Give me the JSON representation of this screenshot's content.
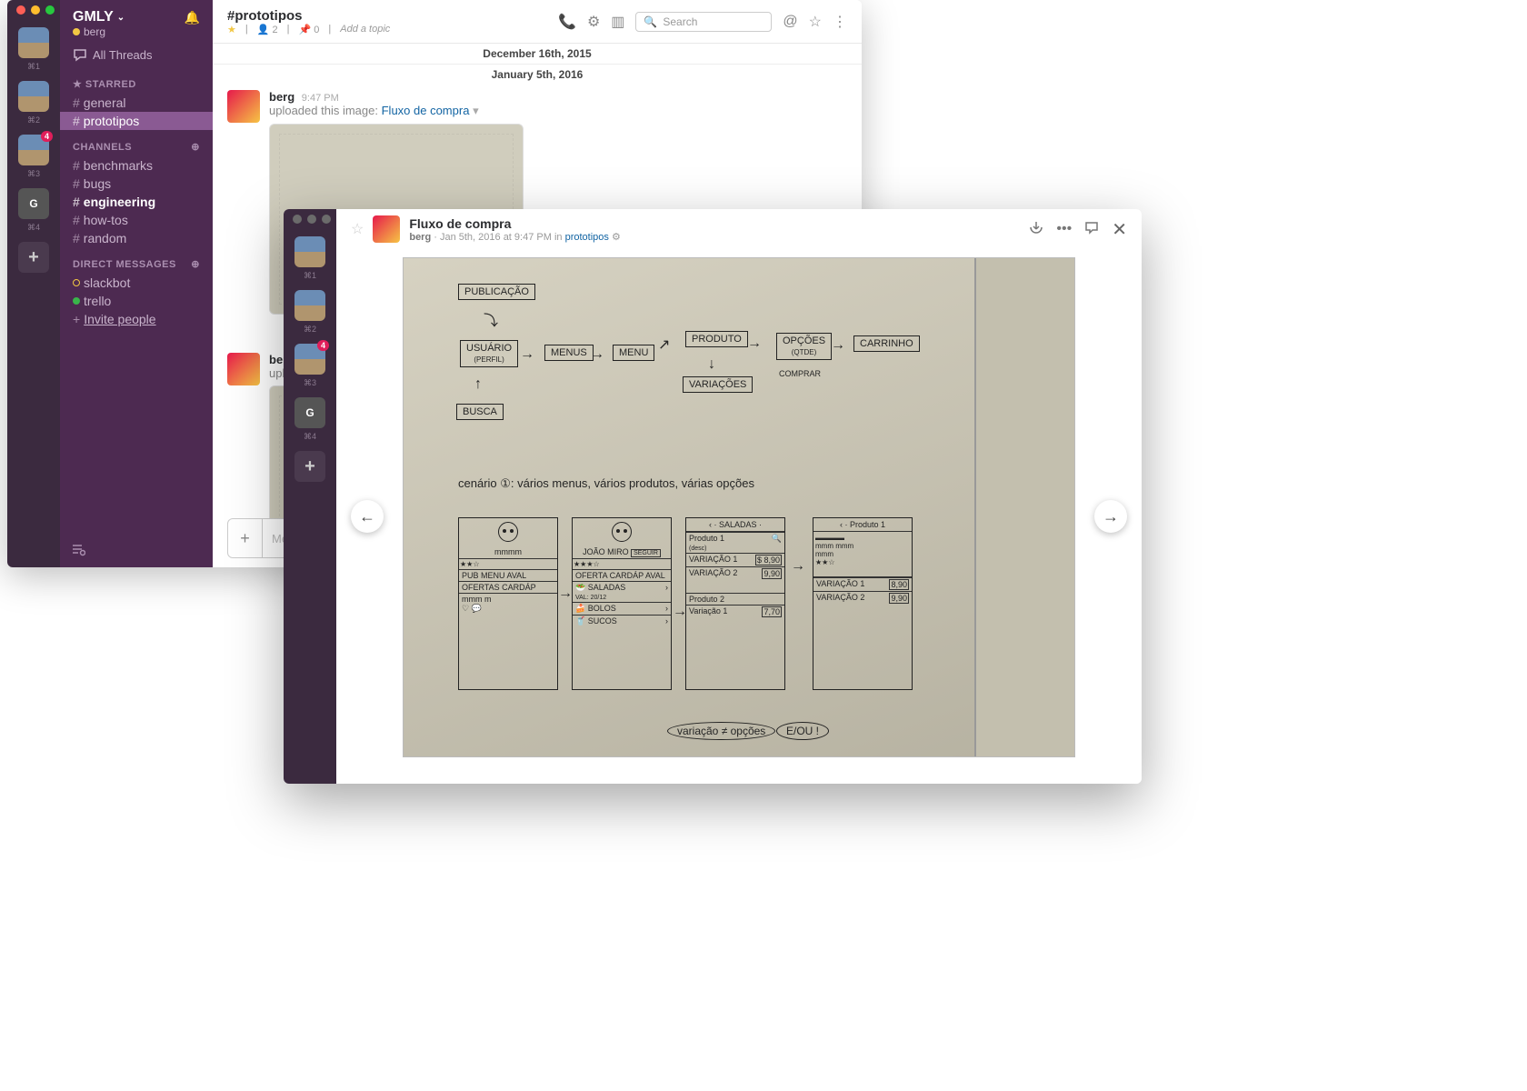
{
  "slack": {
    "team_name": "GMLY",
    "user_name": "berg",
    "all_threads": "All Threads",
    "sections": {
      "starred": "STARRED",
      "channels": "CHANNELS",
      "dms": "DIRECT MESSAGES"
    },
    "starred": [
      {
        "name": "general"
      },
      {
        "name": "prototipos",
        "selected": true
      }
    ],
    "channels": [
      {
        "name": "benchmarks"
      },
      {
        "name": "bugs"
      },
      {
        "name": "engineering",
        "unread": true
      },
      {
        "name": "how-tos"
      },
      {
        "name": "random"
      }
    ],
    "dms": [
      {
        "name": "slackbot",
        "presence": "away"
      },
      {
        "name": "trello",
        "presence": "active"
      }
    ],
    "invite": "Invite people",
    "workspaces": [
      {
        "key": "⌘1"
      },
      {
        "key": "⌘2"
      },
      {
        "key": "⌘3",
        "badge": "4"
      },
      {
        "key": "⌘4",
        "letter": "G"
      }
    ],
    "channel": {
      "name": "#prototipos",
      "members": "2",
      "pins": "0",
      "topic_placeholder": "Add a topic",
      "search_placeholder": "Search"
    },
    "dates": {
      "d1": "December 16th, 2015",
      "d2": "January 5th, 2016"
    },
    "msg1": {
      "user": "berg",
      "time": "9:47 PM",
      "action": "uploaded this image:",
      "filename": "Fluxo de compra"
    },
    "msg2": {
      "user": "berg",
      "action": "uploa"
    },
    "composer_placeholder": "Mess"
  },
  "viewer": {
    "title": "Fluxo de compra",
    "author": "berg",
    "meta": "Jan 5th, 2016 at 9:47 PM in",
    "channel": "prototipos",
    "workspaces": [
      {
        "key": "⌘1"
      },
      {
        "key": "⌘2"
      },
      {
        "key": "⌘3",
        "badge": "4"
      },
      {
        "key": "⌘4",
        "letter": "G"
      }
    ]
  },
  "sketch": {
    "nodes": {
      "publicacao": "PUBLICAÇÃO",
      "usuario": "USUÁRIO",
      "usuario_sub": "(PERFIL)",
      "menus": "MENUS",
      "menu": "MENU",
      "produto": "PRODUTO",
      "variacoes": "VARIAÇÕES",
      "opcoes": "OPÇÕES",
      "opcoes_sub": "(QTDE)",
      "comprar": "COMPRAR",
      "carrinho": "CARRINHO",
      "busca": "BUSCA"
    },
    "caption": "cenário ①: vários menus, vários produtos, várias opções",
    "footer1": "variação ≠ opções",
    "footer2": "E/OU !",
    "wires": {
      "w1_name": "mmmm",
      "w1_tabs": "PUB MENU AVAL",
      "w1_btn": "OFERTAS CARDÁP",
      "w2_name": "JOÃO MIRO",
      "w2_btn": "SEGUIR",
      "w2_tabs": "OFERTA CARDÁP AVAL",
      "w2_r1": "SALADAS",
      "w2_r1b": "VAL: 20/12",
      "w2_r2": "BOLOS",
      "w2_r3": "SUCOS",
      "w3_head": "SALADAS",
      "w3_p1": "Produto 1",
      "w3_p1d": "(desc)",
      "w3_v1": "VARIAÇÃO 1",
      "w3_v1p": "8,90",
      "w3_v2": "VARIAÇÃO 2",
      "w3_v2p": "9,90",
      "w3_p2": "Produto 2",
      "w3_v3": "Variação 1",
      "w3_v3p": "7,70",
      "w4_head": "Produto 1",
      "w4_v1": "VARIAÇÃO 1",
      "w4_v1p": "8,90",
      "w4_v2": "VARIAÇÃO 2",
      "w4_v2p": "9,90"
    }
  }
}
